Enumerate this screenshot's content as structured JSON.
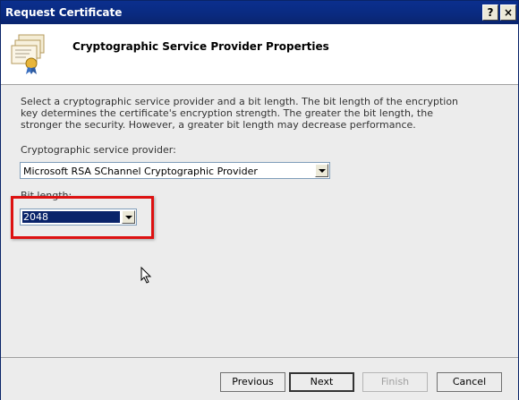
{
  "window": {
    "title": "Request Certificate",
    "help_glyph": "?",
    "close_glyph": "×"
  },
  "header": {
    "title": "Cryptographic Service Provider Properties",
    "icon": "certificate-icon"
  },
  "content": {
    "description": "Select a cryptographic service provider and a bit length. The bit length of the encryption key determines the certificate's encryption strength. The greater the bit length, the stronger the security. However, a greater bit length may decrease performance.",
    "csp_label": "Cryptographic service provider:",
    "csp_value": "Microsoft RSA SChannel Cryptographic Provider",
    "bit_length_label": "Bit length:",
    "bit_length_value": "2048"
  },
  "buttons": {
    "previous": "Previous",
    "next": "Next",
    "finish": "Finish",
    "cancel": "Cancel"
  },
  "colors": {
    "titlebar": "#0b2f8e",
    "highlight": "#dd1111",
    "selection": "#0a246a"
  }
}
